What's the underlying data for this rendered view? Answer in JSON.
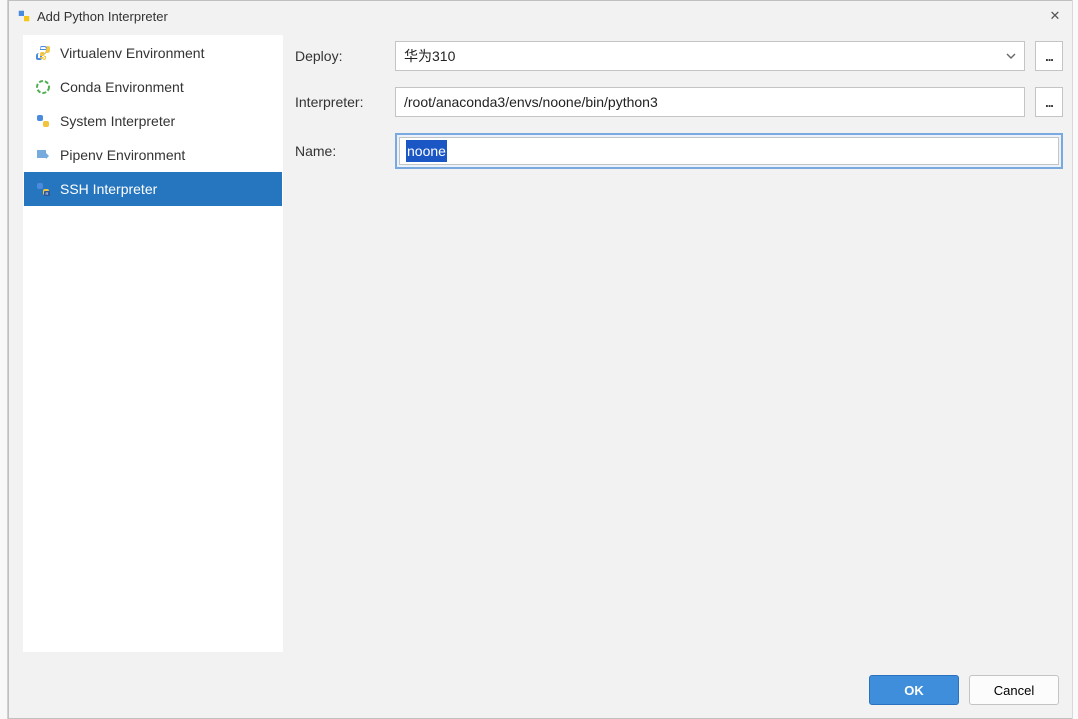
{
  "window": {
    "title": "Add Python Interpreter",
    "close_glyph": "✕"
  },
  "sidebar": {
    "items": [
      {
        "label": "Virtualenv Environment",
        "icon": "python"
      },
      {
        "label": "Conda Environment",
        "icon": "conda"
      },
      {
        "label": "System Interpreter",
        "icon": "python"
      },
      {
        "label": "Pipenv Environment",
        "icon": "pipenv"
      },
      {
        "label": "SSH Interpreter",
        "icon": "python-ssh"
      }
    ],
    "selected_index": 4
  },
  "form": {
    "deploy_label": "Deploy:",
    "deploy_value": "华为310",
    "deploy_browse": "...",
    "interpreter_label": "Interpreter:",
    "interpreter_value": "/root/anaconda3/envs/noone/bin/python3",
    "interpreter_browse": "...",
    "name_label": "Name:",
    "name_value": "noone"
  },
  "footer": {
    "ok": "OK",
    "cancel": "Cancel"
  },
  "colors": {
    "selection_bg": "#2675bf",
    "primary_btn": "#3e8edc",
    "focus_ring": "#7aa9df"
  }
}
